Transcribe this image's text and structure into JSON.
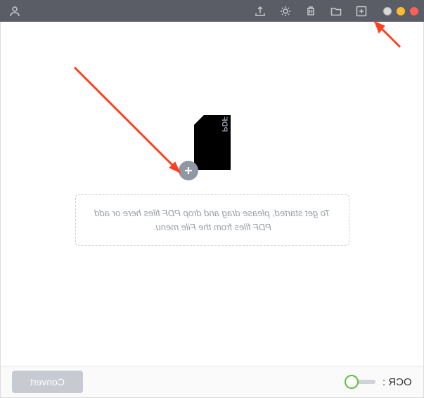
{
  "titlebar": {
    "icons": {
      "add_file": "add-file-icon",
      "folder": "folder-icon",
      "trash": "trash-icon",
      "settings": "gear-icon",
      "export": "export-icon",
      "user": "user-icon"
    }
  },
  "main": {
    "pdf_label": "PDF",
    "hint_text": "To get started, please drag and drop PDF files here or add PDF files from the File menu."
  },
  "footer": {
    "ocr_label": "OCR :",
    "ocr_on": false,
    "convert_label": "Convert"
  }
}
